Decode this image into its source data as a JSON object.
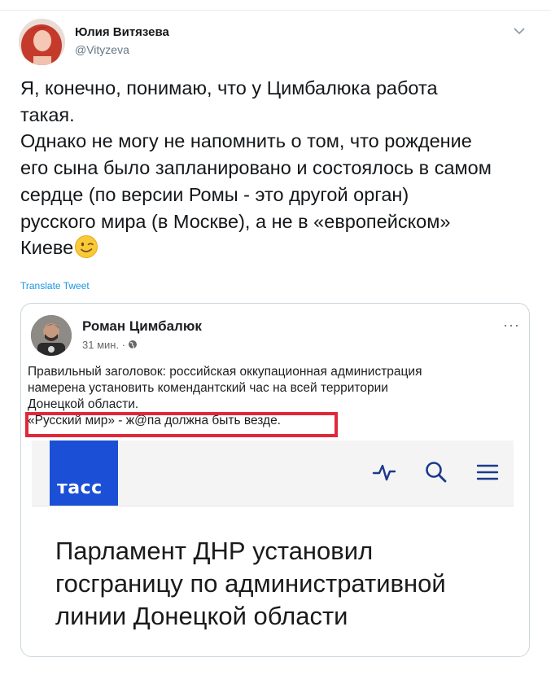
{
  "tweet": {
    "author_name": "Юлия Витязева",
    "author_handle": "@Vityzeva",
    "text_lines": [
      "Я, конечно, понимаю, что у Цимбалюка работа",
      "такая.",
      "Однако не могу не напомнить о том, что рождение",
      "его сына было запланировано и состоялось в самом",
      "сердце (по версии Ромы - это другой орган)",
      "русского мира (в Москве), а не в «европейском»",
      "Киеве"
    ],
    "translate_label": "Translate Tweet",
    "icons": {
      "menu": "chevron-down-icon",
      "emoji": "winking-face-emoji"
    }
  },
  "embedded_post": {
    "author_name": "Роман Цимбалюк",
    "time": "31 мин. ·",
    "more": "···",
    "text_lines": [
      "Правильный заголовок: российская оккупационная администрация",
      "намерена установить комендантский час  на всей территории",
      "Донецкой области.",
      "«Русский мир» - ж@па должна быть везде."
    ],
    "highlight_color": "#e0283b",
    "icons": {
      "privacy": "globe-icon"
    }
  },
  "news_screenshot": {
    "logo_text": "тасс",
    "brand_color": "#1b4fd6",
    "icons": [
      "activity-icon",
      "search-icon",
      "menu-icon"
    ],
    "headline_lines": [
      "Парламент ДНР установил",
      "госграницу по административной",
      "линии Донецкой области"
    ]
  }
}
